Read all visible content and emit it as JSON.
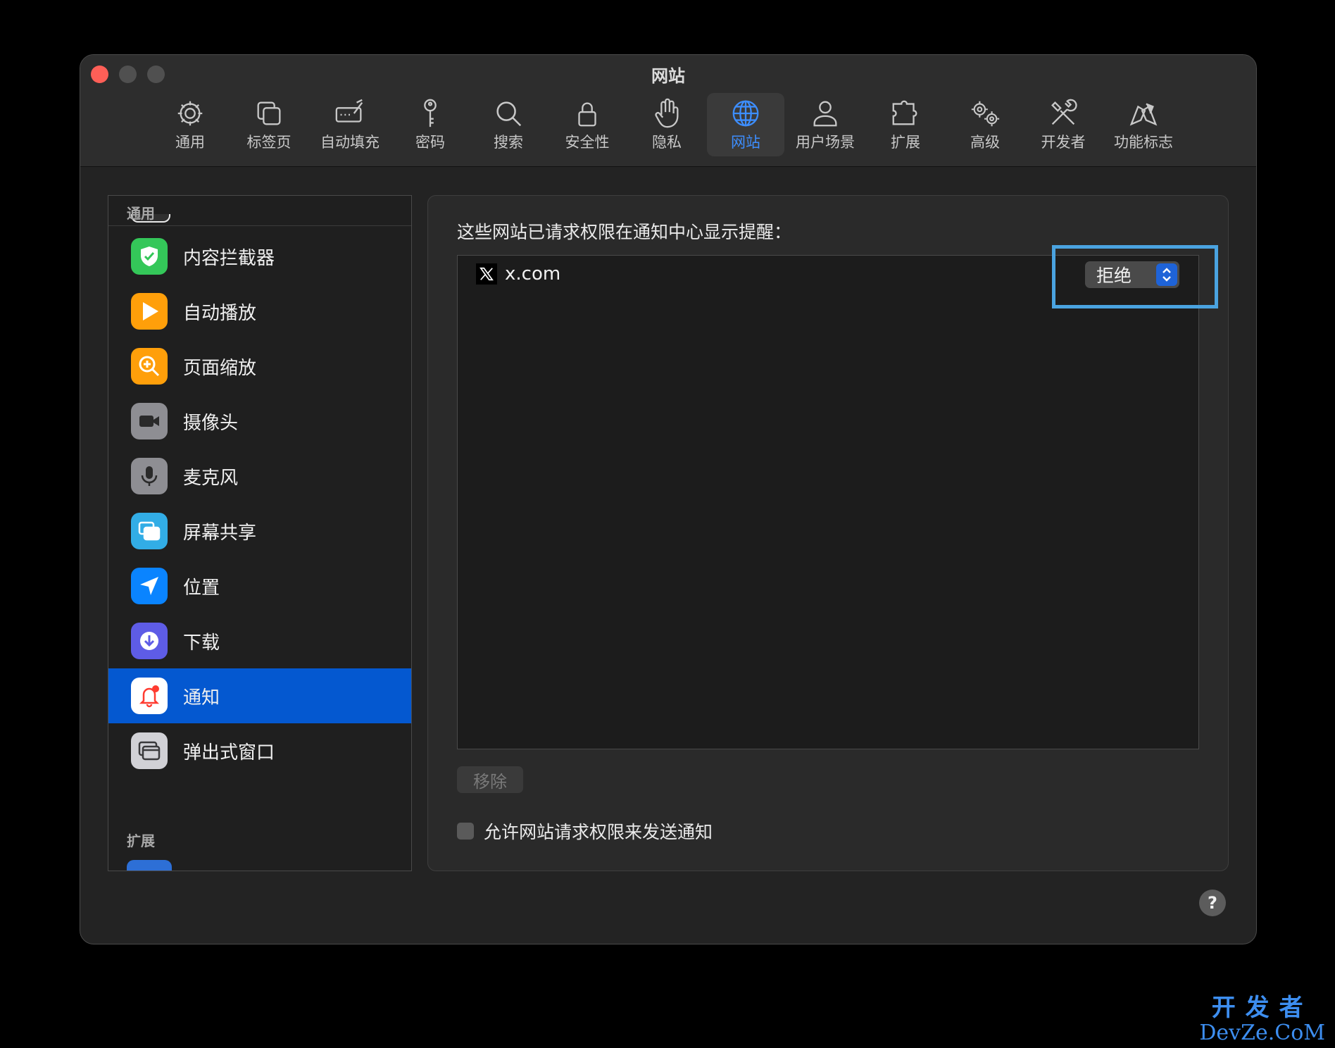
{
  "window": {
    "title": "网站"
  },
  "toolbar": {
    "items": [
      {
        "label": "通用",
        "icon": "gear-icon",
        "active": false
      },
      {
        "label": "标签页",
        "icon": "tabs-icon",
        "active": false
      },
      {
        "label": "自动填充",
        "icon": "autofill-icon",
        "active": false
      },
      {
        "label": "密码",
        "icon": "key-icon",
        "active": false
      },
      {
        "label": "搜索",
        "icon": "magnifier-icon",
        "active": false
      },
      {
        "label": "安全性",
        "icon": "lock-icon",
        "active": false
      },
      {
        "label": "隐私",
        "icon": "hand-icon",
        "active": false
      },
      {
        "label": "网站",
        "icon": "globe-icon",
        "active": true
      },
      {
        "label": "用户场景",
        "icon": "person-icon",
        "active": false
      },
      {
        "label": "扩展",
        "icon": "puzzle-icon",
        "active": false
      },
      {
        "label": "高级",
        "icon": "gears-icon",
        "active": false
      },
      {
        "label": "开发者",
        "icon": "tools-icon",
        "active": false
      },
      {
        "label": "功能标志",
        "icon": "flags-icon",
        "active": false
      }
    ]
  },
  "sidebar": {
    "section_general": "通用",
    "section_extensions": "扩展",
    "items": [
      {
        "label": "内容拦截器",
        "icon": "shield-check-icon",
        "color": "#34c759",
        "selected": false
      },
      {
        "label": "自动播放",
        "icon": "play-icon",
        "color": "#ff9f0a",
        "selected": false
      },
      {
        "label": "页面缩放",
        "icon": "zoom-icon",
        "color": "#ff9f0a",
        "selected": false
      },
      {
        "label": "摄像头",
        "icon": "camera-icon",
        "color": "#8e8e93",
        "selected": false
      },
      {
        "label": "麦克风",
        "icon": "microphone-icon",
        "color": "#8e8e93",
        "selected": false
      },
      {
        "label": "屏幕共享",
        "icon": "screen-share-icon",
        "color": "#32ade6",
        "selected": false
      },
      {
        "label": "位置",
        "icon": "location-arrow-icon",
        "color": "#0a84ff",
        "selected": false
      },
      {
        "label": "下载",
        "icon": "download-icon",
        "color": "#5e5ce6",
        "selected": false
      },
      {
        "label": "通知",
        "icon": "bell-icon",
        "color": "#ffffff",
        "selected": true
      },
      {
        "label": "弹出式窗口",
        "icon": "popup-window-icon",
        "color": "#d1d1d6",
        "selected": false
      }
    ]
  },
  "panel": {
    "description": "这些网站已请求权限在通知中心显示提醒：",
    "sites": [
      {
        "name": "x.com",
        "icon": "x-logo-icon",
        "permission": "拒绝"
      }
    ],
    "remove_label": "移除",
    "allow_checkbox_label": "允许网站请求权限来发送通知",
    "allow_checked": false
  },
  "help_label": "?",
  "watermark": {
    "top": "开发者",
    "bottom": "DevZe.CoM"
  }
}
